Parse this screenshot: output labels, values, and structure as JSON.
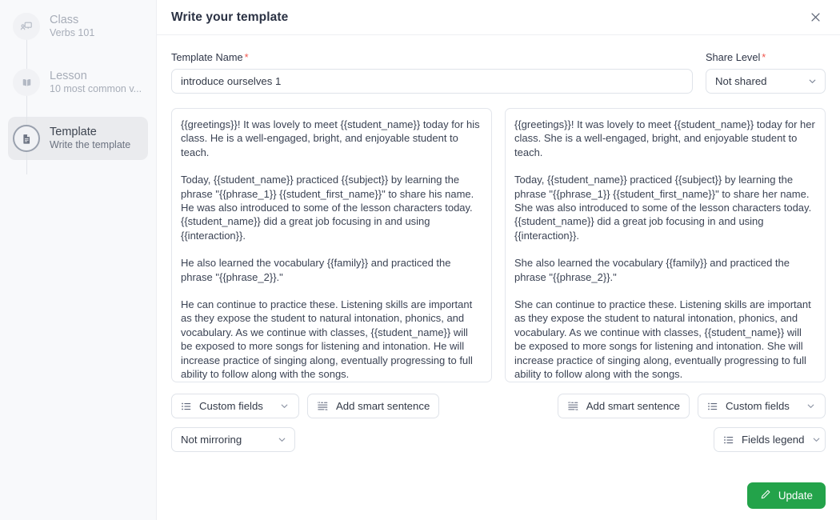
{
  "sidebar": {
    "steps": [
      {
        "icon": "class-presentation-icon",
        "title": "Class",
        "subtitle": "Verbs 101",
        "active": false
      },
      {
        "icon": "book-icon",
        "title": "Lesson",
        "subtitle": "10 most common v...",
        "active": false
      },
      {
        "icon": "document-icon",
        "title": "Template",
        "subtitle": "Write the template",
        "active": true
      }
    ]
  },
  "header": {
    "title": "Write your template",
    "close_icon": "close-icon"
  },
  "form": {
    "template_name": {
      "label": "Template Name",
      "required_marker": "*",
      "value": "introduce ourselves 1",
      "placeholder": "Template Name"
    },
    "share_level": {
      "label": "Share Level",
      "required_marker": "*",
      "value": "Not shared",
      "options": [
        "Not shared"
      ]
    }
  },
  "editors": {
    "left": {
      "paragraphs": [
        "{{greetings}}! It was lovely to meet {{student_name}} today for his class. He is a well-engaged, bright, and enjoyable student to teach.",
        "Today, {{student_name}} practiced {{subject}} by learning the phrase \"{{phrase_1}} {{student_first_name}}\" to share his name. He was also introduced to some of the lesson characters today. {{student_name}} did a great job focusing in and using {{interaction}}.",
        "He also learned the vocabulary {{family}} and practiced the phrase \"{{phrase_2}}.\"",
        "He can continue to practice these. Listening skills are important as they expose the student to natural intonation, phonics, and vocabulary. As we continue with classes, {{student_name}} will be exposed to more songs for listening and intonation. He will increase practice of singing along, eventually progressing to full ability to follow along with the songs."
      ]
    },
    "right": {
      "paragraphs": [
        "{{greetings}}! It was lovely to meet {{student_name}} today for her class. She is a well-engaged, bright, and enjoyable student to teach.",
        "Today, {{student_name}} practiced {{subject}} by learning the phrase \"{{phrase_1}} {{student_first_name}}\" to share her name. She was also introduced to some of the lesson characters today. {{student_name}} did a great job focusing in and using {{interaction}}.",
        "She also learned the vocabulary {{family}} and practiced the phrase \"{{phrase_2}}.\"",
        "She can continue to practice these. Listening skills are important as they expose the student to natural intonation, phonics, and vocabulary. As we continue with classes, {{student_name}} will be exposed to more songs for listening and intonation. She will increase practice of singing along, eventually progressing to full ability to follow along with the songs."
      ]
    }
  },
  "toolbar": {
    "left_custom_fields": "Custom fields",
    "left_add_smart_sentence": "Add smart sentence",
    "mirroring": "Not mirroring",
    "right_add_smart_sentence": "Add smart sentence",
    "right_custom_fields": "Custom fields",
    "fields_legend": "Fields legend"
  },
  "footer": {
    "update_label": "Update",
    "update_icon": "pencil-icon",
    "update_color": "#23a34a"
  }
}
